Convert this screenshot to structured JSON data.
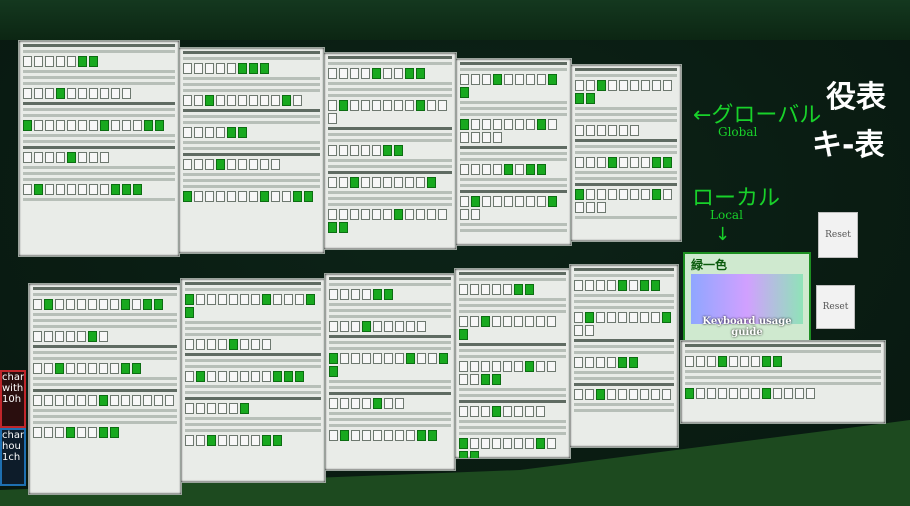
{
  "labels": {
    "global_jp": "←グローバル",
    "global_en": "Global",
    "local_jp": "ローカル",
    "local_en": "Local",
    "down_arrow": "↓",
    "title_line1": "役表",
    "title_line2": "キ-表"
  },
  "buttons": {
    "reset_top": "Reset",
    "reset_bottom": "Reset"
  },
  "keyboard_panel": {
    "title": "緑一色",
    "caption": "Keyboard usage guide"
  },
  "side_tags": [
    {
      "lines": [
        "chan",
        "with",
        "10h"
      ],
      "color": "#c0262b"
    },
    {
      "lines": [
        "chan",
        "hou",
        "1ch"
      ],
      "color": "#1e6fb0"
    }
  ],
  "colors": {
    "accent_green": "#18d12a",
    "tile_green": "#18a91f",
    "wall": "#0a1d13"
  }
}
